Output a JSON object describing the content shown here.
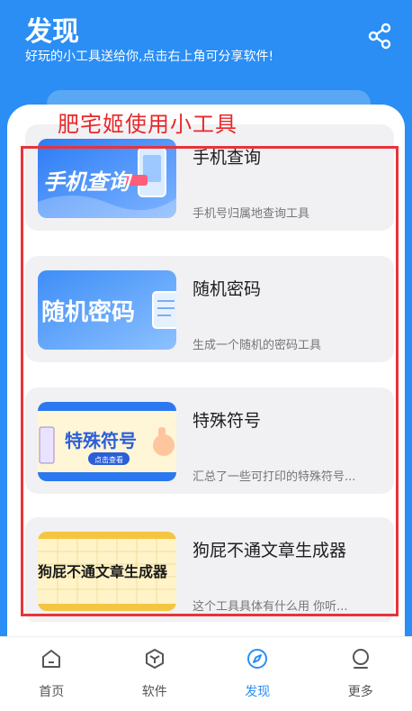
{
  "header": {
    "title": "发现",
    "subtitle": "好玩的小工具送给你,点击右上角可分享软件!",
    "share_icon": "share-icon"
  },
  "overlay_label": "肥宅姬使用小工具",
  "tools": [
    {
      "title": "手机查询",
      "description": "手机号归属地查询工具",
      "thumb_text": "手机查询",
      "thumb_colors": [
        "#2b7cf6",
        "#7fb4ff"
      ]
    },
    {
      "title": "随机密码",
      "description": "生成一个随机的密码工具",
      "thumb_text": "随机密码",
      "thumb_colors": [
        "#3e8ef7",
        "#8cc1ff"
      ]
    },
    {
      "title": "特殊符号",
      "description": "汇总了一些可打印的特殊符号...",
      "thumb_text": "特殊符号",
      "thumb_badge": "点击查看",
      "thumb_colors": [
        "#fff6d8",
        "#2b78f0"
      ]
    },
    {
      "title": "狗屁不通文章生成器",
      "description": "这个工具具体有什么用 你听...",
      "thumb_text": "狗屁不通文章生成器",
      "thumb_colors": [
        "#fff3c7",
        "#f5c542"
      ]
    }
  ],
  "bottom_nav": {
    "items": [
      {
        "label": "首页",
        "icon": "home-icon",
        "active": false
      },
      {
        "label": "软件",
        "icon": "box-icon",
        "active": false
      },
      {
        "label": "发现",
        "icon": "compass-icon",
        "active": true
      },
      {
        "label": "更多",
        "icon": "person-icon",
        "active": false
      }
    ]
  },
  "colors": {
    "brand": "#2a8ef5",
    "annotation_red": "#e8333a"
  }
}
